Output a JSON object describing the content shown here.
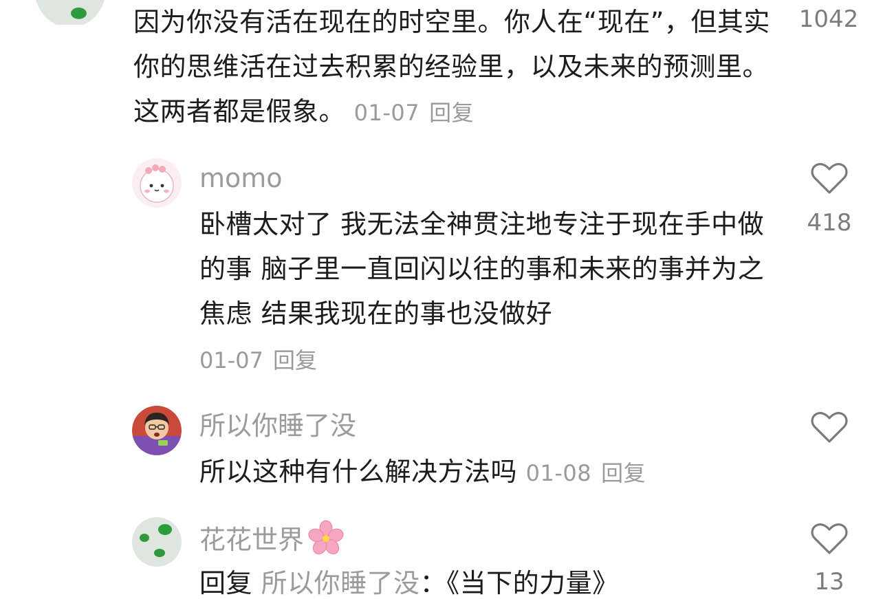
{
  "comments": [
    {
      "text": "因为你没有活在现在的时空里。你人在“现在”，但其实你的思维活在过去积累的经验里，以及未来的预测里。这两者都是假象。",
      "date": "01-07",
      "reply_label": "回复",
      "likes": "1042"
    },
    {
      "username": "momo",
      "text": "卧槽太对了 我无法全神贯注地专注于现在手中做的事 脑子里一直回闪以往的事和未来的事并为之焦虑 结果我现在的事也没做好",
      "date": "01-07",
      "reply_label": "回复",
      "likes": "418"
    },
    {
      "username": "所以你睡了没",
      "text": "所以这种有什么解决方法吗",
      "date": "01-08",
      "reply_label": "回复"
    },
    {
      "username": "花花世界",
      "reply_prefix": "回复",
      "reply_target": "所以你睡了没",
      "text": "：《当下的力量》",
      "likes": "13"
    }
  ],
  "icons": {
    "like": "heart-outline-icon",
    "flower": "cherry-blossom-icon"
  },
  "colors": {
    "text": "#1c1c1c",
    "muted": "#9a9a9a",
    "heart": "#7a7a7a"
  }
}
